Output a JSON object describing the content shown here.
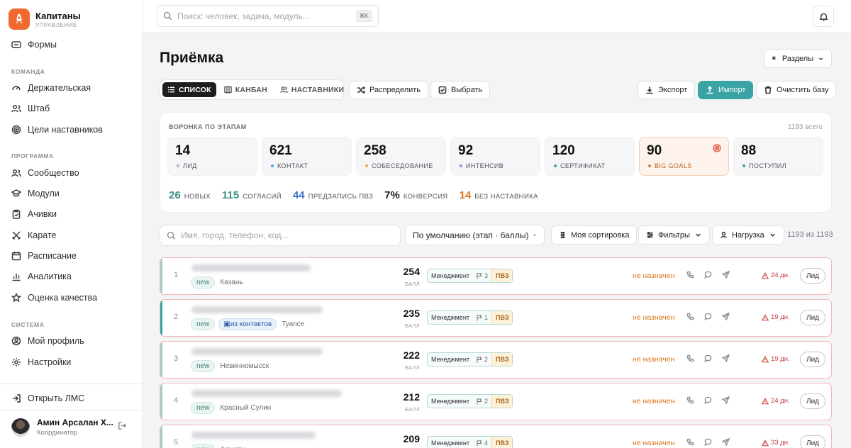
{
  "brand": {
    "title": "Капитаны",
    "subtitle": "управление"
  },
  "sidebar": {
    "top_item": "Формы",
    "sections": [
      {
        "title": "Команда",
        "items": [
          "Держательская",
          "Штаб",
          "Цели наставников"
        ]
      },
      {
        "title": "Программа",
        "items": [
          "Сообщество",
          "Модули",
          "Ачивки",
          "Карате",
          "Расписание",
          "Аналитика",
          "Оценка качества"
        ]
      },
      {
        "title": "Система",
        "items": [
          "Мой профиль",
          "Настройки"
        ]
      }
    ],
    "open_lms": "Открыть ЛМС",
    "user": {
      "name": "Амин Арсалан Х...",
      "role": "Координатор"
    }
  },
  "topbar": {
    "search_placeholder": "Поиск: человек, задача, модуль...",
    "shortcut": "⌘K"
  },
  "page": {
    "title": "Приёмка",
    "sections_button": "Разделы",
    "tabs": [
      "Список",
      "Канбан",
      "Наставники"
    ],
    "distribute": "Распределить",
    "select": "Выбрать",
    "export": "Экспорт",
    "import": "Импорт",
    "clear": "Очистить базу"
  },
  "funnel": {
    "title": "Воронка по этапам",
    "total": "1193 всего",
    "stages": [
      {
        "value": "14",
        "label": "Лид",
        "color": "#b5b5bb"
      },
      {
        "value": "621",
        "label": "Контакт",
        "color": "#4aa3d9"
      },
      {
        "value": "258",
        "label": "Собеседование",
        "color": "#e0b43a"
      },
      {
        "value": "92",
        "label": "Интенсив",
        "color": "#9b8ae0"
      },
      {
        "value": "120",
        "label": "Сертификат",
        "color": "#3aa4a4"
      },
      {
        "value": "90",
        "label": "Big goals",
        "color": "#e07a3a"
      },
      {
        "value": "88",
        "label": "Поступил",
        "color": "#3aa4a4"
      }
    ],
    "summary": [
      {
        "value": "26",
        "label": "новых",
        "color": "#3a8f82"
      },
      {
        "value": "115",
        "label": "согласий",
        "color": "#3a8f82"
      },
      {
        "value": "44",
        "label": "предзапись ПВЗ",
        "color": "#3a72c4"
      },
      {
        "value": "7%",
        "label": "конверсия",
        "color": "#1d1d1f"
      },
      {
        "value": "14",
        "label": "без наставника",
        "color": "#d9731b"
      }
    ]
  },
  "filters": {
    "search_placeholder": "Имя, город, телефон, код...",
    "sort": "По умолчанию (этап · баллы)",
    "my_sort": "Моя сортировка",
    "filters": "Фильтры",
    "load": "Нагрузка",
    "count": "1193 из 1193"
  },
  "rows": [
    {
      "num": "1",
      "tag": "new",
      "contacts": "",
      "city": "Казань",
      "score": "254",
      "score_label": "БАЛЛ",
      "track": "Менеджмент",
      "flags": "3",
      "pvz": "ПВЗ",
      "mentor": "не назначен",
      "days": "24 дн.",
      "stage": "Лид"
    },
    {
      "num": "2",
      "tag": "new",
      "contacts": "из контактов",
      "city": "Туапсе",
      "score": "235",
      "score_label": "БАЛЛ",
      "track": "Менеджмент",
      "flags": "1",
      "pvz": "ПВЗ",
      "mentor": "не назначен",
      "days": "19 дн.",
      "stage": "Лид"
    },
    {
      "num": "3",
      "tag": "new",
      "contacts": "",
      "city": "Невинномысск",
      "score": "222",
      "score_label": "БАЛЛ",
      "track": "Менеджмент",
      "flags": "2",
      "pvz": "ПВЗ",
      "mentor": "не назначен",
      "days": "19 дн.",
      "stage": "Лид"
    },
    {
      "num": "4",
      "tag": "new",
      "contacts": "",
      "city": "Красный Сулин",
      "score": "212",
      "score_label": "БАЛЛ",
      "track": "Менеджмент",
      "flags": "2",
      "pvz": "ПВЗ",
      "mentor": "не назначен",
      "days": "24 дн.",
      "stage": "Лид"
    },
    {
      "num": "5",
      "tag": "new",
      "contacts": "",
      "city": "Алматы",
      "score": "209",
      "score_label": "БАЛЛ",
      "track": "Менеджмент",
      "flags": "4",
      "pvz": "ПВЗ",
      "mentor": "не назначен",
      "days": "33 дн.",
      "stage": "Лид"
    }
  ]
}
